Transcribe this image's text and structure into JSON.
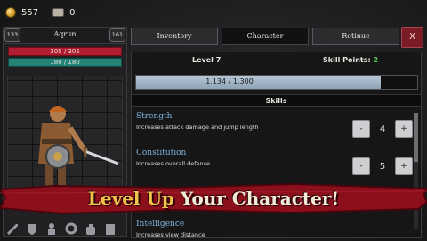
{
  "resources": {
    "gold": "557",
    "chests": "0"
  },
  "character": {
    "name": "Aqrun",
    "level_left": "133",
    "level_right": "161",
    "hp_text": "305 / 305",
    "xp_text": "180 / 180"
  },
  "tabs": [
    {
      "label": "Inventory"
    },
    {
      "label": "Character"
    },
    {
      "label": "Retinue"
    }
  ],
  "close_label": "X",
  "stats": {
    "level_label": "Level 7",
    "skill_points_label": "Skill Points:",
    "skill_points_value": "2",
    "progress_text": "1,134 / 1,300",
    "progress_fraction": 0.87
  },
  "skills_header": "Skills",
  "skills": [
    {
      "name": "Strength",
      "desc": "Increases attack damage and jump length",
      "value": "4"
    },
    {
      "name": "Constitution",
      "desc": "Increases overall defense",
      "value": "5"
    },
    {
      "name": "Intelligence",
      "desc": "Increases view distance",
      "value": ""
    }
  ],
  "stepper": {
    "minus": "-",
    "plus": "+"
  },
  "banner": {
    "part1": "Level Up",
    "part2": "Your Character!"
  },
  "colors": {
    "hp": "#b21d32",
    "xp": "#258277",
    "accent_skill": "#7fb2d9",
    "banner": "#8c0f1c",
    "points": "#58d25b"
  },
  "bottom_icons": [
    "sword-icon",
    "shield-icon",
    "person-icon",
    "gear-icon",
    "bag-icon",
    "book-icon",
    "tower-icon"
  ]
}
